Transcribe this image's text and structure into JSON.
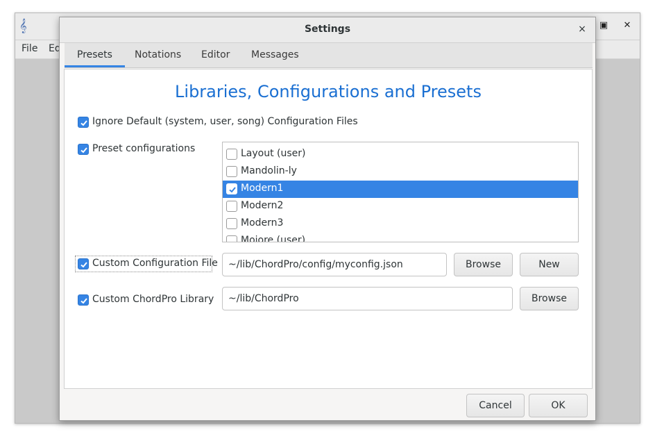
{
  "main_window": {
    "menu": [
      "File",
      "Ed"
    ],
    "icons": [
      "app-icon",
      "maximize-icon",
      "close-icon"
    ]
  },
  "dialog": {
    "title": "Settings",
    "close_glyph": "×",
    "tabs": [
      "Presets",
      "Notations",
      "Editor",
      "Messages"
    ],
    "active_tab": "Presets",
    "heading": "Libraries, Configurations and Presets",
    "ignore_default": {
      "label": "Ignore Default (system, user, song) Configuration Files",
      "checked": true
    },
    "preset_configurations": {
      "label": "Preset configurations",
      "checked": true,
      "items": [
        {
          "label": "Layout (user)",
          "checked": false,
          "selected": false
        },
        {
          "label": "Mandolin-ly",
          "checked": false,
          "selected": false
        },
        {
          "label": "Modern1",
          "checked": true,
          "selected": true
        },
        {
          "label": "Modern2",
          "checked": false,
          "selected": false
        },
        {
          "label": "Modern3",
          "checked": false,
          "selected": false
        },
        {
          "label": "Mojore (user)",
          "checked": false,
          "selected": false
        }
      ]
    },
    "custom_config": {
      "label": "Custom Configuration File",
      "checked": true,
      "value": "~/lib/ChordPro/config/myconfig.json",
      "browse_label": "Browse",
      "new_label": "New"
    },
    "custom_library": {
      "label": "Custom ChordPro Library",
      "checked": true,
      "value": "~/lib/ChordPro",
      "browse_label": "Browse"
    },
    "cancel_label": "Cancel",
    "ok_label": "OK"
  },
  "colors": {
    "accent": "#3584e4",
    "heading": "#1a6fd2"
  }
}
